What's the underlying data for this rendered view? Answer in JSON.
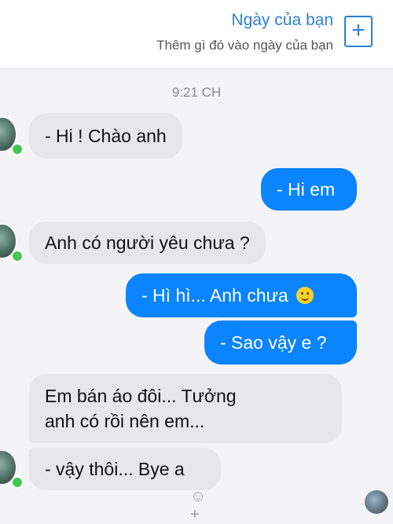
{
  "header": {
    "title": "Ngày của bạn",
    "subtitle": "Thêm gì đó vào ngày của bạn",
    "add_icon": "plus-icon",
    "add_label": "+"
  },
  "conversation": {
    "timestamp": "9:21 CH",
    "messages": [
      {
        "from": "them",
        "text": "- Hi ! Chào anh"
      },
      {
        "from": "me",
        "text": "- Hi em"
      },
      {
        "from": "them",
        "text": "Anh có người yêu chưa ?"
      },
      {
        "from": "me",
        "text": "- Hì hì... Anh chưa",
        "emoji": "slight-smile-emoji"
      },
      {
        "from": "me",
        "text": "- Sao vậy e ?"
      },
      {
        "from": "them",
        "text_lines": [
          "Em bán áo đôi... Tưởng",
          "anh có rồi nên em..."
        ]
      },
      {
        "from": "them",
        "text": "- vậy thôi... Bye a"
      }
    ]
  },
  "footer": {
    "react_icon": "add-reaction-icon",
    "react_label": "☺+"
  },
  "colors": {
    "accent": "#2e7fd6",
    "outgoing_bubble": "#0a84ff",
    "incoming_bubble": "#e7e7ea",
    "online_dot": "#44c451"
  }
}
